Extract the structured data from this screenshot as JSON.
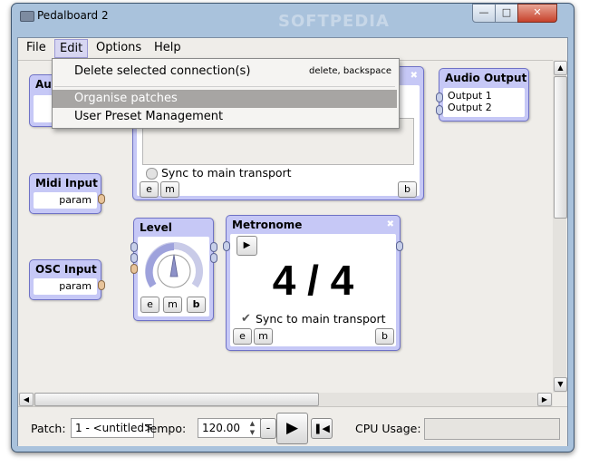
{
  "window": {
    "title": "Pedalboard 2",
    "watermark": "SOFTPEDIA"
  },
  "menubar": {
    "items": [
      "File",
      "Edit",
      "Options",
      "Help"
    ]
  },
  "edit_menu": {
    "items": [
      {
        "label": "Delete selected connection(s)",
        "shortcut": "delete, backspace"
      },
      {
        "label": "Organise patches",
        "shortcut": ""
      },
      {
        "label": "User Preset Management",
        "shortcut": ""
      }
    ]
  },
  "nodes": {
    "audio_input": {
      "title_partial": "Au"
    },
    "midi_input": {
      "title": "Midi Input",
      "param": "param"
    },
    "osc_input": {
      "title": "OSC Input",
      "param": "param"
    },
    "recorder": {
      "sync_label": "Sync to main transport",
      "btn_e": "e",
      "btn_m": "m",
      "btn_b": "b"
    },
    "audio_output": {
      "title": "Audio Output",
      "ports": [
        "Output 1",
        "Output 2"
      ]
    },
    "level": {
      "title": "Level",
      "btn_e": "e",
      "btn_m": "m",
      "btn_b": "b"
    },
    "metronome": {
      "title": "Metronome",
      "time_sig": "4 / 4",
      "sync_label": "Sync to main transport",
      "sync_checked": true,
      "btn_e": "e",
      "btn_m": "m",
      "btn_b": "b"
    }
  },
  "bottom": {
    "patch_label": "Patch:",
    "patch_value": "1 - <untitled>",
    "tempo_label": "Tempo:",
    "tempo_value": "120.00",
    "minus_label": "-",
    "cpu_label": "CPU Usage:"
  },
  "colors": {
    "node_bg": "#c6c8f6",
    "node_border": "#6f72c6",
    "highlight": "#a7a5a3",
    "record": "#e8493c"
  }
}
